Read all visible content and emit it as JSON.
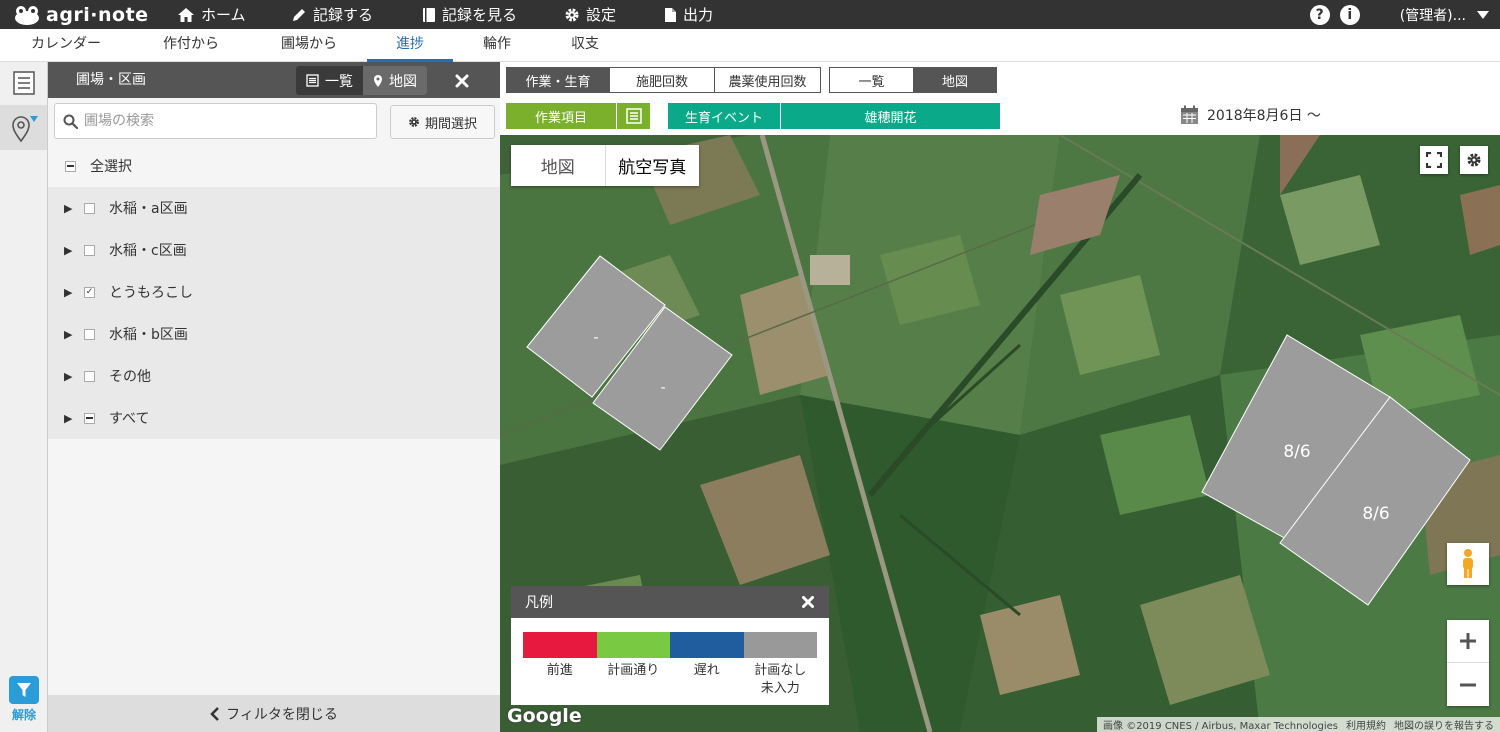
{
  "app": {
    "logo_text": "agri·note"
  },
  "topnav": [
    {
      "id": "home",
      "label": "ホーム"
    },
    {
      "id": "record",
      "label": "記録する"
    },
    {
      "id": "view",
      "label": "記録を見る"
    },
    {
      "id": "settings",
      "label": "設定"
    },
    {
      "id": "export",
      "label": "出力"
    }
  ],
  "top_right": {
    "help": "?",
    "info": "i",
    "user": "(管理者)..."
  },
  "subnav": [
    "カレンダー",
    "作付から",
    "圃場から",
    "進捗",
    "輪作",
    "収支"
  ],
  "filter": {
    "title": "圃場・区画",
    "list_label": "一覧",
    "map_label": "地図",
    "search_placeholder": "圃場の検索",
    "period_label": "期間選択",
    "select_all": "全選択",
    "items": [
      {
        "label": "水稲・a区画",
        "checked": "unchecked"
      },
      {
        "label": "水稲・c区画",
        "checked": "unchecked"
      },
      {
        "label": "とうもろこし",
        "checked": "checked"
      },
      {
        "label": "水稲・b区画",
        "checked": "unchecked"
      },
      {
        "label": "その他",
        "checked": "unchecked"
      },
      {
        "label": "すべて",
        "checked": "partial"
      }
    ],
    "close_label": "フィルタを閉じる",
    "release_label": "解除"
  },
  "controls": {
    "mode1": [
      "作業・生育",
      "施肥回数",
      "農薬使用回数"
    ],
    "mode2": [
      "一覧",
      "地図"
    ],
    "work_item": "作業項目",
    "growth_event": "生育イベント",
    "growth_value": "雄穂開花",
    "date": "2018年8月6日 ～"
  },
  "map": {
    "type_map": "地図",
    "type_aerial": "航空写真",
    "fields": [
      {
        "id": "f1",
        "label": "-"
      },
      {
        "id": "f2",
        "label": "-"
      },
      {
        "id": "f3",
        "label": "8/6"
      },
      {
        "id": "f4",
        "label": "8/6"
      }
    ],
    "legend": {
      "title": "凡例",
      "items": [
        {
          "label": "前進",
          "color": "#e8193f"
        },
        {
          "label": "計画通り",
          "color": "#7ac943"
        },
        {
          "label": "遅れ",
          "color": "#1f5d9e"
        },
        {
          "label": "計画なし\n未入力",
          "color": "#999999"
        }
      ]
    },
    "google": "Google",
    "attribution": [
      "画像 ©2019 CNES / Airbus, Maxar Technologies",
      "利用規約",
      "地図の誤りを報告する"
    ]
  },
  "colors": {
    "accent_green": "#7ab02c",
    "teal": "#0aa98a",
    "active_blue": "#2a6db0"
  }
}
